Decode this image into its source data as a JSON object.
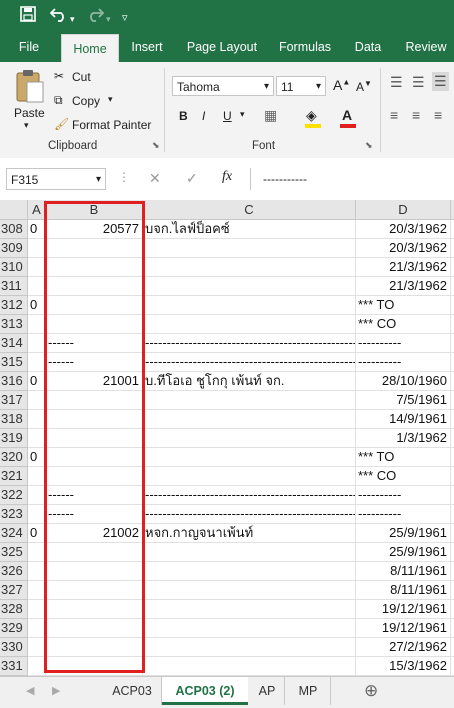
{
  "qat": {
    "save_icon": "save-icon",
    "undo_icon": "undo-icon",
    "redo_icon": "redo-icon",
    "customize_icon": "chevron-down-icon"
  },
  "tabs": [
    "File",
    "Home",
    "Insert",
    "Page Layout",
    "Formulas",
    "Data",
    "Review"
  ],
  "active_tab": "Home",
  "clipboard": {
    "paste": "Paste",
    "cut": "Cut",
    "copy": "Copy",
    "format_painter": "Format Painter",
    "group": "Clipboard"
  },
  "font": {
    "name": "Tahoma",
    "size": "11",
    "group": "Font",
    "grow": "A",
    "shrink": "A",
    "bold": "B",
    "italic": "I",
    "underline": "U"
  },
  "formula_bar": {
    "name_box": "F315",
    "fx": "fx",
    "content": "-----------"
  },
  "columns": [
    "A",
    "B",
    "C",
    "D"
  ],
  "rows": [
    {
      "n": "308",
      "a": "0",
      "b": "20577",
      "c": "บจก.ไลฟ์ป็อคซ์",
      "d": "20/3/1962"
    },
    {
      "n": "309",
      "a": "",
      "b": "",
      "c": "",
      "d": "20/3/1962"
    },
    {
      "n": "310",
      "a": "",
      "b": "",
      "c": "",
      "d": "21/3/1962"
    },
    {
      "n": "311",
      "a": "",
      "b": "",
      "c": "",
      "d": "21/3/1962"
    },
    {
      "n": "312",
      "a": "0",
      "b": "",
      "c": "",
      "d": "*** TO"
    },
    {
      "n": "313",
      "a": "",
      "b": "",
      "c": "",
      "d": "*** CO"
    },
    {
      "n": "314",
      "a": "",
      "b": "------",
      "c": "--------------------------------------------------",
      "d": "----------"
    },
    {
      "n": "315",
      "a": "",
      "b": "------",
      "c": "--------------------------------------------------",
      "d": "----------"
    },
    {
      "n": "316",
      "a": "0",
      "b": "21001",
      "c": "บ.ทีโอเอ ชูโกกุ เพ้นท์ จก.",
      "d": "28/10/1960"
    },
    {
      "n": "317",
      "a": "",
      "b": "",
      "c": "",
      "d": "7/5/1961"
    },
    {
      "n": "318",
      "a": "",
      "b": "",
      "c": "",
      "d": "14/9/1961"
    },
    {
      "n": "319",
      "a": "",
      "b": "",
      "c": "",
      "d": "1/3/1962"
    },
    {
      "n": "320",
      "a": "0",
      "b": "",
      "c": "",
      "d": "*** TO"
    },
    {
      "n": "321",
      "a": "",
      "b": "",
      "c": "",
      "d": "*** CO"
    },
    {
      "n": "322",
      "a": "",
      "b": "------",
      "c": "--------------------------------------------------",
      "d": "----------"
    },
    {
      "n": "323",
      "a": "",
      "b": "------",
      "c": "--------------------------------------------------",
      "d": "----------"
    },
    {
      "n": "324",
      "a": "0",
      "b": "21002",
      "c": "หจก.กาญจนาเพ้นท์",
      "d": "25/9/1961"
    },
    {
      "n": "325",
      "a": "",
      "b": "",
      "c": "",
      "d": "25/9/1961"
    },
    {
      "n": "326",
      "a": "",
      "b": "",
      "c": "",
      "d": "8/11/1961"
    },
    {
      "n": "327",
      "a": "",
      "b": "",
      "c": "",
      "d": "8/11/1961"
    },
    {
      "n": "328",
      "a": "",
      "b": "",
      "c": "",
      "d": "19/12/1961"
    },
    {
      "n": "329",
      "a": "",
      "b": "",
      "c": "",
      "d": "19/12/1961"
    },
    {
      "n": "330",
      "a": "",
      "b": "",
      "c": "",
      "d": "27/2/1962"
    },
    {
      "n": "331",
      "a": "",
      "b": "",
      "c": "",
      "d": "15/3/1962"
    }
  ],
  "sheets": [
    "ACP03",
    "ACP03 (2)",
    "AP",
    "MP"
  ],
  "active_sheet": "ACP03 (2)",
  "colors": {
    "excel_green": "#217346",
    "highlight": "#e02020"
  }
}
